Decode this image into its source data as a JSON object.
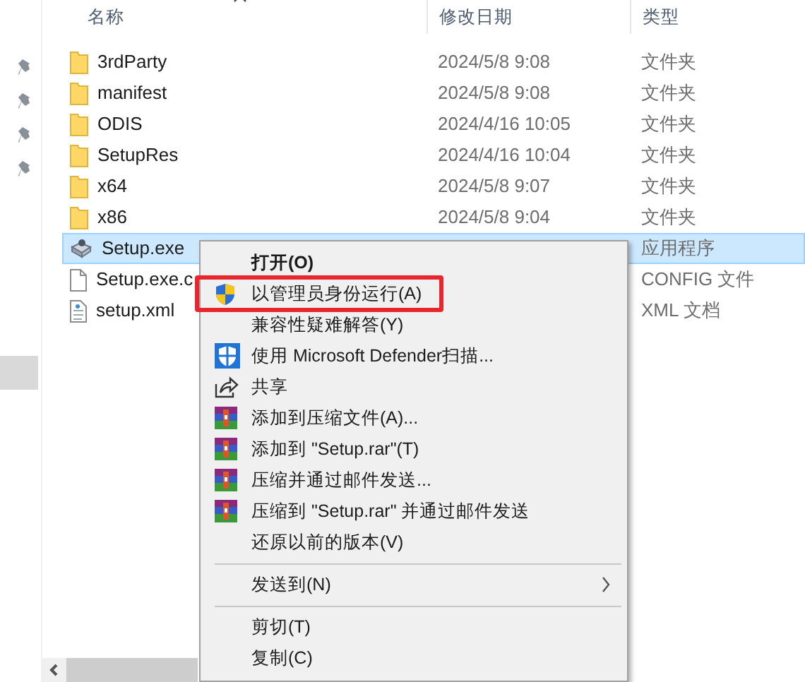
{
  "columns": [
    {
      "label": "名称"
    },
    {
      "label": "修改日期"
    },
    {
      "label": "类型"
    }
  ],
  "files": [
    {
      "kind": "folder",
      "name": "3rdParty",
      "date": "2024/5/8 9:08",
      "type": "文件夹",
      "selected": false
    },
    {
      "kind": "folder",
      "name": "manifest",
      "date": "2024/5/8 9:08",
      "type": "文件夹",
      "selected": false
    },
    {
      "kind": "folder",
      "name": "ODIS",
      "date": "2024/4/16 10:05",
      "type": "文件夹",
      "selected": false
    },
    {
      "kind": "folder",
      "name": "SetupRes",
      "date": "2024/4/16 10:04",
      "type": "文件夹",
      "selected": false
    },
    {
      "kind": "folder",
      "name": "x64",
      "date": "2024/5/8 9:07",
      "type": "文件夹",
      "selected": false
    },
    {
      "kind": "folder",
      "name": "x86",
      "date": "2024/5/8 9:04",
      "type": "文件夹",
      "selected": false
    },
    {
      "kind": "exe",
      "name": "Setup.exe",
      "type": "应用程序",
      "selected": true
    },
    {
      "kind": "file",
      "name": "Setup.exe.c",
      "type": "CONFIG 文件",
      "selected": false
    },
    {
      "kind": "xml",
      "name": "setup.xml",
      "type": "XML 文档",
      "selected": false
    }
  ],
  "context_menu": [
    {
      "kind": "item",
      "label": "打开(O)",
      "bold": true
    },
    {
      "kind": "shield",
      "label": "以管理员身份运行(A)",
      "highlighted": true
    },
    {
      "kind": "item",
      "label": "兼容性疑难解答(Y)"
    },
    {
      "kind": "defender",
      "label": "使用 Microsoft Defender扫描..."
    },
    {
      "kind": "share",
      "label": "共享"
    },
    {
      "kind": "archive",
      "label": "添加到压缩文件(A)..."
    },
    {
      "kind": "archive",
      "label": "添加到 \"Setup.rar\"(T)"
    },
    {
      "kind": "archive",
      "label": "压缩并通过邮件发送..."
    },
    {
      "kind": "archive",
      "label": "压缩到 \"Setup.rar\" 并通过邮件发送"
    },
    {
      "kind": "item",
      "label": "还原以前的版本(V)"
    },
    {
      "kind": "separator"
    },
    {
      "kind": "item",
      "label": "发送到(N)",
      "submenu": true
    },
    {
      "kind": "separator"
    },
    {
      "kind": "item",
      "label": "剪切(T)"
    },
    {
      "kind": "item",
      "label": "复制(C)"
    }
  ]
}
